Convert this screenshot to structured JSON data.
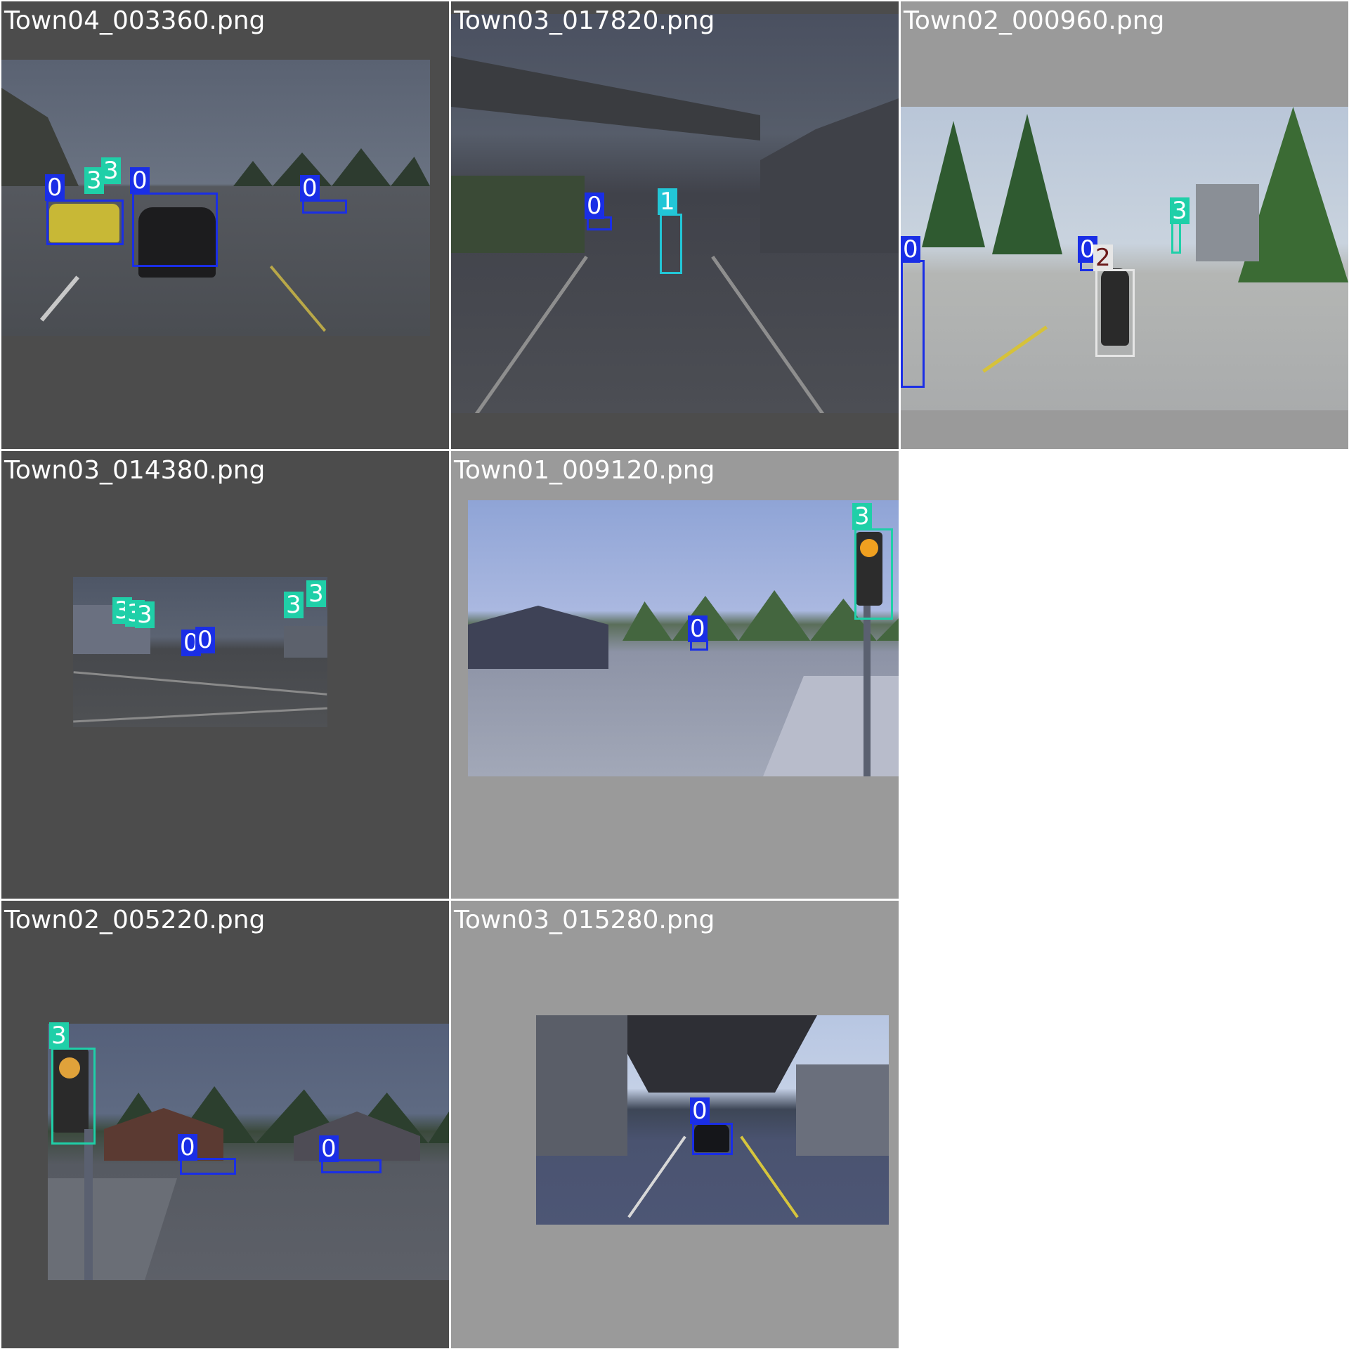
{
  "grid": {
    "tiles": [
      {
        "title": "Town04_003360.png",
        "labels": [
          "0",
          "3",
          "3",
          "0",
          "0"
        ]
      },
      {
        "title": "Town03_017820.png",
        "labels": [
          "0",
          "1"
        ]
      },
      {
        "title": "Town02_000960.png",
        "labels": [
          "3",
          "0",
          "0",
          "2"
        ]
      },
      {
        "title": "Town03_014380.png",
        "labels": [
          "3",
          "3",
          "3",
          "3",
          "3",
          "0",
          "0"
        ]
      },
      {
        "title": "Town01_009120.png",
        "labels": [
          "3",
          "0"
        ]
      },
      {
        "title": "Town02_005220.png",
        "labels": [
          "3",
          "0",
          "0"
        ]
      },
      {
        "title": "Town03_015280.png",
        "labels": [
          "0"
        ]
      }
    ]
  },
  "colors": {
    "class_0": "#1a2ee6",
    "class_1": "#22c6d6",
    "class_2": "#e6e6e6",
    "class_3": "#1fcfa8",
    "title_text": "#ffffff",
    "dark_bg": "#4d4d4d",
    "light_bg": "#9a9a9a"
  }
}
